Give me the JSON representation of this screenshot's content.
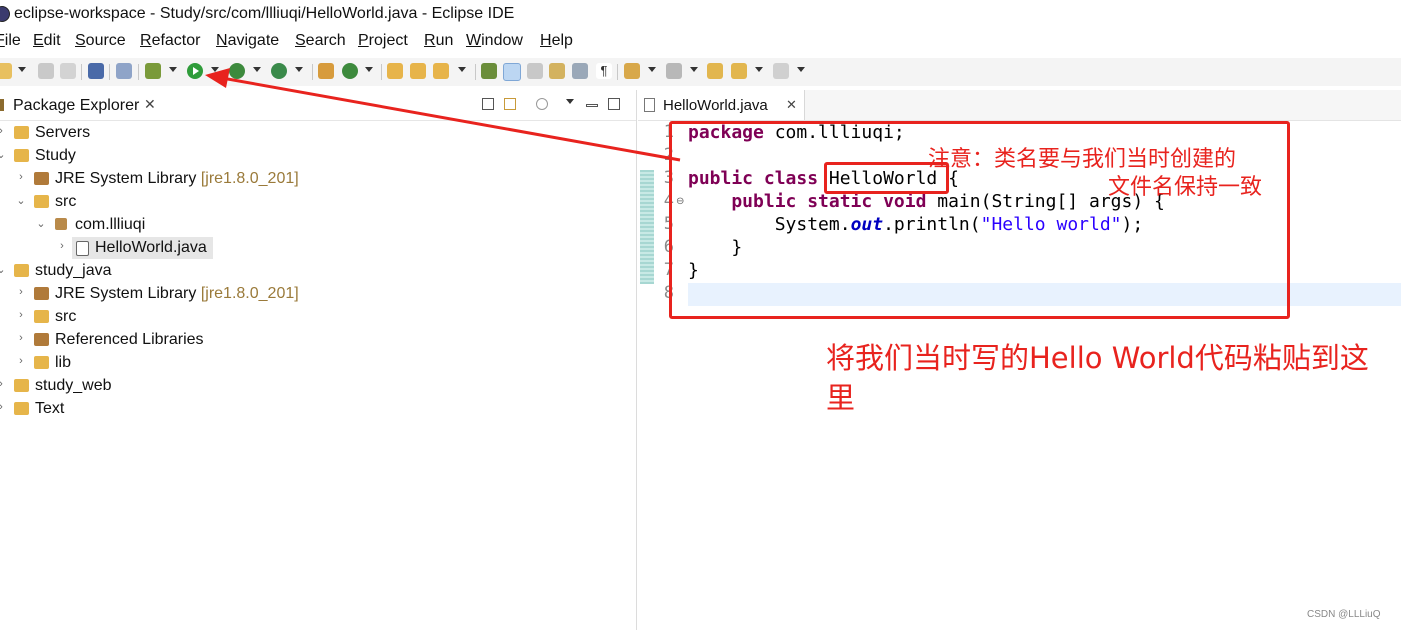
{
  "window": {
    "title": "eclipse-workspace - Study/src/com/llliuqi/HelloWorld.java - Eclipse IDE"
  },
  "menu": [
    "File",
    "Edit",
    "Source",
    "Refactor",
    "Navigate",
    "Search",
    "Project",
    "Run",
    "Window",
    "Help"
  ],
  "explorer": {
    "title": "Package Explorer",
    "close": "✕",
    "tree": [
      {
        "label": "Servers",
        "decoration": "",
        "twisty": "›"
      },
      {
        "label": "Study",
        "decoration": "",
        "twisty": "⌄"
      },
      {
        "label": "JRE System Library",
        "decoration": "[jre1.8.0_201]",
        "twisty": "›"
      },
      {
        "label": "src",
        "decoration": "",
        "twisty": "⌄"
      },
      {
        "label": "com.llliuqi",
        "decoration": "",
        "twisty": "⌄"
      },
      {
        "label": "HelloWorld.java",
        "decoration": "",
        "twisty": "›"
      },
      {
        "label": "study_java",
        "decoration": "",
        "twisty": "⌄"
      },
      {
        "label": "JRE System Library",
        "decoration": "[jre1.8.0_201]",
        "twisty": "›"
      },
      {
        "label": "src",
        "decoration": "",
        "twisty": "›"
      },
      {
        "label": "Referenced Libraries",
        "decoration": "",
        "twisty": "›"
      },
      {
        "label": "lib",
        "decoration": "",
        "twisty": "›"
      },
      {
        "label": "study_web",
        "decoration": "",
        "twisty": "›"
      },
      {
        "label": "Text",
        "decoration": "",
        "twisty": "›"
      }
    ]
  },
  "editor": {
    "tab_label": "HelloWorld.java",
    "tab_close": "✕",
    "line_numbers": [
      "1",
      "2",
      "3",
      "4",
      "5",
      "6",
      "7",
      "8"
    ],
    "code": {
      "l1_kw": "package",
      "l1_rest": " com.llliuqi;",
      "l3_kw": "public class",
      "l3_rest": " HelloWorld {",
      "l4_kw": "    public static void",
      "l4_rest": " main(String[] args) {",
      "l5_pre": "        System.",
      "l5_field": "out",
      "l5_mid": ".println(",
      "l5_str": "\"Hello world\"",
      "l5_end": ");",
      "l6": "    }",
      "l7": "}"
    }
  },
  "annotations": {
    "note_line1": "注意：类名要与我们当时创建的",
    "note_line2": "文件名保持一致",
    "note_paste": "将我们当时写的Hello World代码粘贴到这里",
    "color": "#e8231e"
  },
  "watermark": "CSDN @LLLiuQ"
}
